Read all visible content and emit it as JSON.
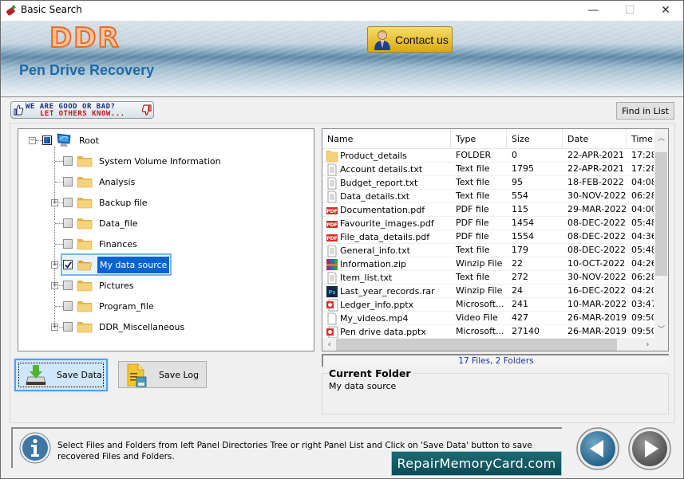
{
  "window": {
    "title": "Basic Search",
    "controls": {
      "minimize": "—",
      "maximize": "☐",
      "close": "✕"
    }
  },
  "banner": {
    "logo": "DDR",
    "product": "Pen Drive Recovery",
    "contact_label": "Contact us"
  },
  "feedback": {
    "line1": "WE ARE GOOD OR BAD?",
    "line2": "LET OTHERS KNOW..."
  },
  "toolbar": {
    "find_label": "Find in List"
  },
  "tree": {
    "root": {
      "label": "Root",
      "icon": "computer-icon",
      "state": "partial",
      "expanded": true
    },
    "items": [
      {
        "label": "System Volume Information",
        "expandable": false,
        "checked": false,
        "selected": false
      },
      {
        "label": "Analysis",
        "expandable": false,
        "checked": false,
        "selected": false
      },
      {
        "label": "Backup file",
        "expandable": true,
        "checked": false,
        "selected": false
      },
      {
        "label": "Data_file",
        "expandable": false,
        "checked": false,
        "selected": false
      },
      {
        "label": "Finances",
        "expandable": false,
        "checked": false,
        "selected": false
      },
      {
        "label": "My data source",
        "expandable": true,
        "checked": true,
        "selected": true
      },
      {
        "label": "Pictures",
        "expandable": true,
        "checked": false,
        "selected": false
      },
      {
        "label": "Program_file",
        "expandable": false,
        "checked": false,
        "selected": false
      },
      {
        "label": "DDR_Miscellaneous",
        "expandable": true,
        "checked": false,
        "selected": false
      }
    ]
  },
  "list": {
    "columns": [
      "Name",
      "Type",
      "Size",
      "Date",
      "Time"
    ],
    "rows": [
      {
        "icon": "folder",
        "name": "Product_details",
        "type": "FOLDER",
        "size": "0",
        "date": "22-APR-2021",
        "time": "17:28"
      },
      {
        "icon": "text",
        "name": "Account details.txt",
        "type": "Text file",
        "size": "1795",
        "date": "22-APR-2021",
        "time": "17:28"
      },
      {
        "icon": "text",
        "name": "Budget_report.txt",
        "type": "Text file",
        "size": "95",
        "date": "18-FEB-2022",
        "time": "04:08"
      },
      {
        "icon": "text",
        "name": "Data_details.txt",
        "type": "Text file",
        "size": "554",
        "date": "30-NOV-2022",
        "time": "06:28"
      },
      {
        "icon": "pdf",
        "name": "Documentation.pdf",
        "type": "PDF file",
        "size": "115",
        "date": "29-MAR-2022",
        "time": "04:00"
      },
      {
        "icon": "pdf",
        "name": "Favourite_images.pdf",
        "type": "PDF file",
        "size": "1454",
        "date": "08-DEC-2022",
        "time": "05:48"
      },
      {
        "icon": "pdf",
        "name": "File_data_details.pdf",
        "type": "PDF file",
        "size": "1554",
        "date": "08-DEC-2022",
        "time": "04:36"
      },
      {
        "icon": "text",
        "name": "General_info.txt",
        "type": "Text file",
        "size": "179",
        "date": "08-DEC-2022",
        "time": "05:48"
      },
      {
        "icon": "zip",
        "name": "Information.zip",
        "type": "Winzip File",
        "size": "22",
        "date": "10-OCT-2022",
        "time": "04:26"
      },
      {
        "icon": "text",
        "name": "Item_list.txt",
        "type": "Text file",
        "size": "272",
        "date": "30-NOV-2022",
        "time": "06:28"
      },
      {
        "icon": "ps",
        "name": "Last_year_records.rar",
        "type": "Winzip File",
        "size": "24",
        "date": "16-DEC-2022",
        "time": "04:20"
      },
      {
        "icon": "pptx",
        "name": "Ledger_info.pptx",
        "type": "Microsoft...",
        "size": "241",
        "date": "10-MAR-2022",
        "time": "03:47"
      },
      {
        "icon": "blank",
        "name": "My_videos.mp4",
        "type": "Video File",
        "size": "427",
        "date": "26-MAR-2019",
        "time": "09:50"
      },
      {
        "icon": "pptx",
        "name": "Pen drive data.pptx",
        "type": "Microsoft...",
        "size": "27140",
        "date": "26-MAR-2019",
        "time": "09:50"
      }
    ],
    "status": "17 Files, 2 Folders"
  },
  "current_folder": {
    "legend": "Current Folder",
    "value": "My data source"
  },
  "buttons": {
    "save_data": "Save Data",
    "save_log": "Save Log"
  },
  "info": {
    "text": "Select Files and Folders from left Panel Directories Tree or right Panel List and Click on 'Save Data' button to save recovered Files and Folders."
  },
  "watermark": "RepairMemoryCard.com",
  "colors": {
    "accent": "#0a64cf",
    "logo_orange": "#e8692a",
    "product_blue": "#1e6aa8",
    "status_blue": "#1e2fa6",
    "contact_gold": "#e9c43a",
    "watermark_teal": "#0c4c56"
  }
}
